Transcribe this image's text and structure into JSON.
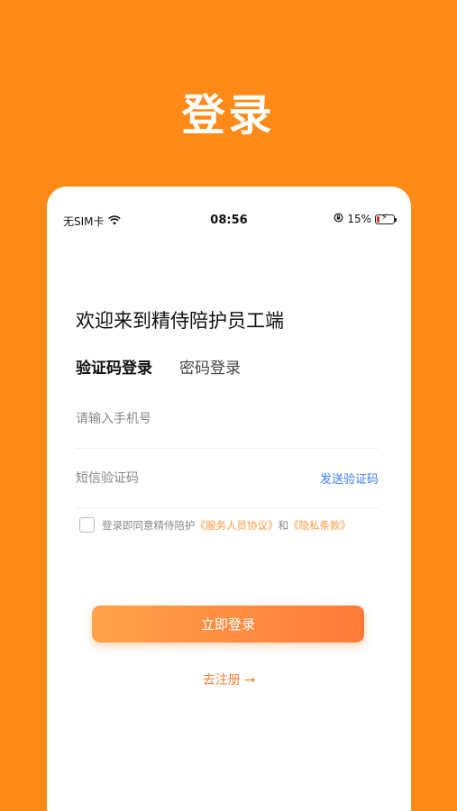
{
  "header": {
    "title": "登录"
  },
  "statusbar": {
    "carrier": "无SIM卡",
    "time": "08:56",
    "battery": "15%"
  },
  "login": {
    "welcome": "欢迎来到精侍陪护员工端",
    "tabs": [
      {
        "label": "验证码登录",
        "active": true
      },
      {
        "label": "密码登录",
        "active": false
      }
    ],
    "phone_placeholder": "请输入手机号",
    "code_placeholder": "短信验证码",
    "send_code": "发送验证码",
    "agreement_prefix": "登录即同意精侍陪护",
    "agreement_link1": "《服务人员协议》",
    "agreement_and": "和",
    "agreement_link2": "《隐私条款》",
    "submit": "立即登录",
    "register": "去注册 →"
  },
  "colors": {
    "brand": "#FF8A17",
    "link": "#3a7ff0"
  }
}
